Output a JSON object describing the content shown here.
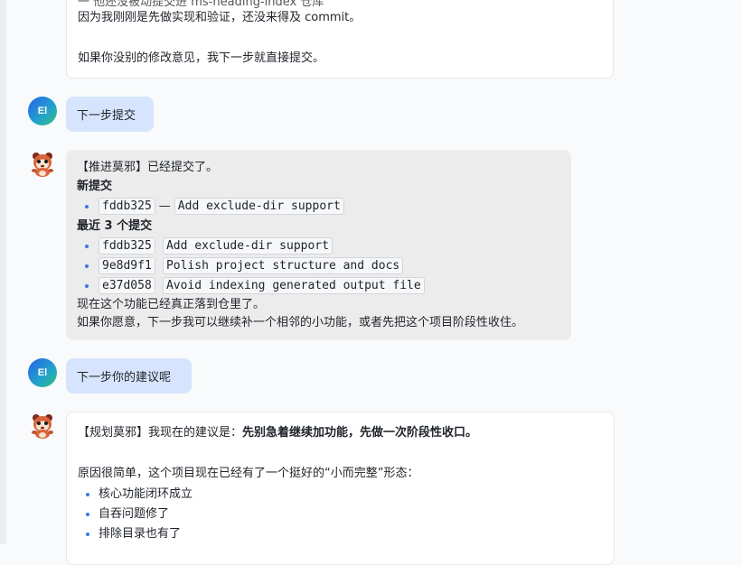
{
  "message_1": {
    "partial_line": "一 他还没被动提交进 ms-heading-index 仓库",
    "line_2": "因为我刚刚是先做实现和验证，还没来得及 commit。",
    "line_3": "如果你没别的修改意见，我下一步就直接提交。"
  },
  "user_avatar_initials": "El",
  "user_msg_1": "下一步提交",
  "bot_msg_1": {
    "intro": "【推进莫邪】已经提交了。",
    "new_commit_heading": "新提交",
    "new_commit": {
      "hash": "fddb325",
      "dash": "—",
      "subject": "Add exclude-dir support"
    },
    "recent_heading": "最近 3 个提交",
    "recent_commits": [
      {
        "hash": "fddb325",
        "subject": "Add exclude-dir support"
      },
      {
        "hash": "9e8d9f1",
        "subject": "Polish project structure and docs"
      },
      {
        "hash": "e37d058",
        "subject": "Avoid indexing generated output file"
      }
    ],
    "line_after_1": "现在这个功能已经真正落到仓里了。",
    "line_after_2": "如果你愿意，下一步我可以继续补一个相邻的小功能，或者先把这个项目阶段性收住。"
  },
  "user_msg_2": "下一步你的建议呢",
  "bot_msg_2": {
    "intro_prefix": "【规划莫邪】我现在的建议是：",
    "intro_bold": "先别急着继续加功能，先做一次阶段性收口。",
    "reason": "原因很简单，这个项目现在已经有了一个挺好的“小而完整”形态：",
    "bullets": [
      "核心功能闭环成立",
      "自吞问题修了",
      "排除目录也有了"
    ]
  },
  "colors": {
    "user_bubble": "#d6e5fd",
    "bot_bubble": "#ececed",
    "bullet": "#3b78e7"
  }
}
